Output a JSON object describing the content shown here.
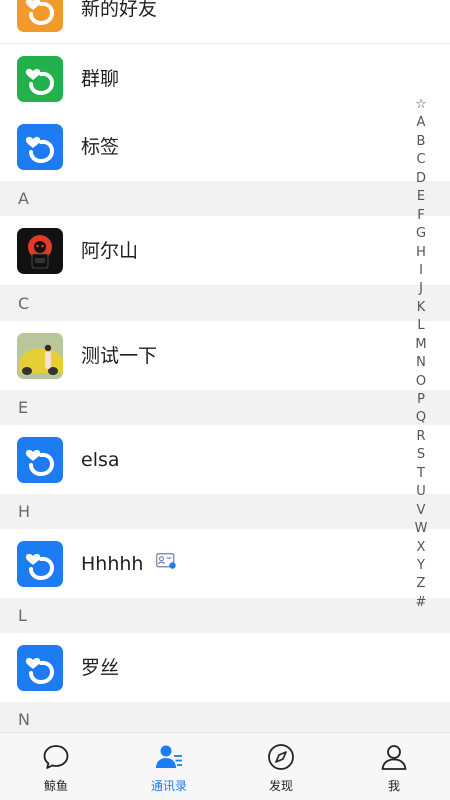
{
  "colors": {
    "accent": "#1d7cf2",
    "orange": "#f39a2c",
    "green": "#22b14c",
    "header_bg": "#f2f2f2"
  },
  "contacts_top": {
    "new_friends": {
      "label": "新的好友",
      "icon": "app-logo-icon"
    },
    "group_chat": {
      "label": "群聊",
      "icon": "app-logo-icon"
    },
    "tags": {
      "label": "标签",
      "icon": "app-logo-icon"
    }
  },
  "sections": {
    "A": {
      "header": "A",
      "contacts": [
        {
          "name": "阿尔山",
          "avatar": "dark-character-avatar"
        }
      ]
    },
    "C": {
      "header": "C",
      "contacts": [
        {
          "name": "测试一下",
          "avatar": "photo-avatar"
        }
      ]
    },
    "E": {
      "header": "E",
      "contacts": [
        {
          "name": "elsa",
          "avatar": "app-logo-icon"
        }
      ]
    },
    "H": {
      "header": "H",
      "contacts": [
        {
          "name": "Hhhhh",
          "avatar": "app-logo-icon",
          "badge": "contact-card-icon"
        }
      ]
    },
    "L": {
      "header": "L",
      "contacts": [
        {
          "name": "罗丝",
          "avatar": "app-logo-icon"
        }
      ]
    },
    "N": {
      "header": "N"
    }
  },
  "alphabet_index": [
    "☆",
    "A",
    "B",
    "C",
    "D",
    "E",
    "F",
    "G",
    "H",
    "I",
    "J",
    "K",
    "L",
    "M",
    "N",
    "O",
    "P",
    "Q",
    "R",
    "S",
    "T",
    "U",
    "V",
    "W",
    "X",
    "Y",
    "Z",
    "#"
  ],
  "tabbar": {
    "tabs": [
      {
        "label": "鲸鱼",
        "icon": "chat-bubble-icon",
        "active": false
      },
      {
        "label": "通讯录",
        "icon": "contacts-icon",
        "active": true
      },
      {
        "label": "发现",
        "icon": "compass-icon",
        "active": false
      },
      {
        "label": "我",
        "icon": "person-icon",
        "active": false
      }
    ]
  }
}
